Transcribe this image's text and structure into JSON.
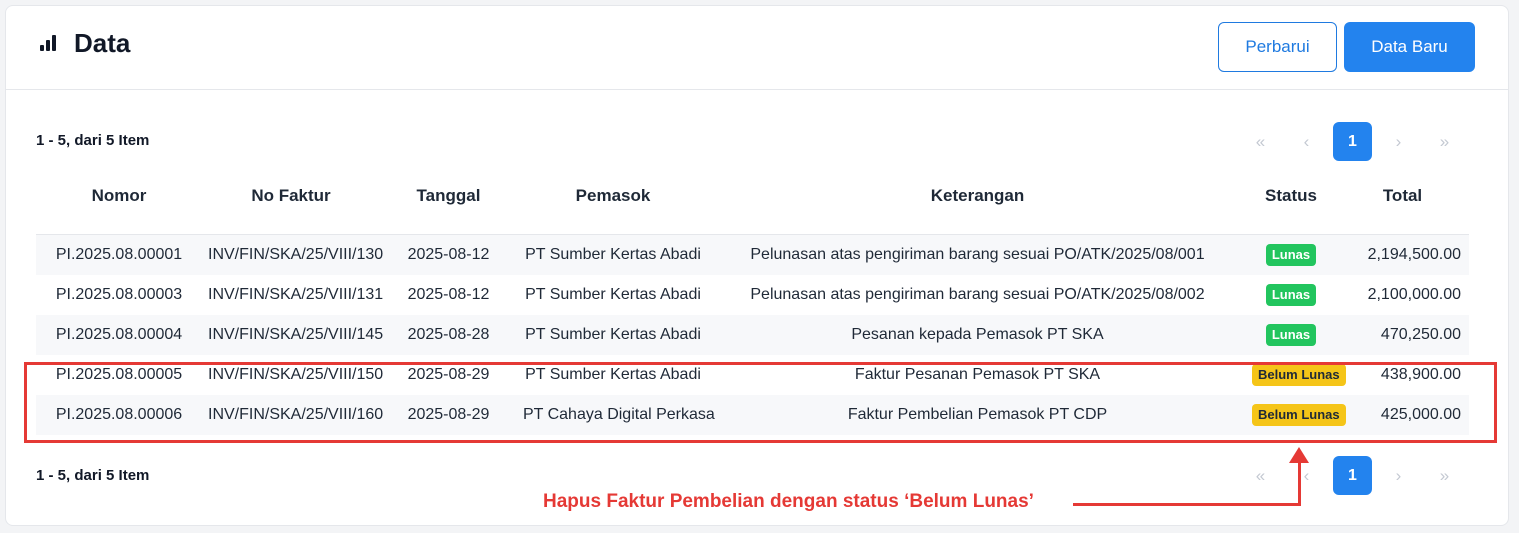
{
  "header": {
    "title": "Data",
    "icon": "bar-chart-icon",
    "refresh_label": "Perbarui",
    "new_label": "Data Baru"
  },
  "summary_top": "1 - 5, dari 5 Item",
  "summary_bottom": "1 - 5, dari 5 Item",
  "pagination": {
    "first": "«",
    "prev": "‹",
    "current": "1",
    "next": "›",
    "last": "»"
  },
  "table": {
    "columns": [
      "Nomor",
      "No Faktur",
      "Tanggal",
      "Pemasok",
      "Keterangan",
      "Status",
      "Total"
    ],
    "rows": [
      {
        "nomor": "PI.2025.08.00001",
        "faktur": "INV/FIN/SKA/25/VIII/130",
        "tanggal": "2025-08-12",
        "pemasok": "PT Sumber Kertas Abadi",
        "keterangan": "Pelunasan atas pengiriman barang sesuai PO/ATK/2025/08/001",
        "status": "Lunas",
        "total": "2,194,500.00"
      },
      {
        "nomor": "PI.2025.08.00003",
        "faktur": "INV/FIN/SKA/25/VIII/131",
        "tanggal": "2025-08-12",
        "pemasok": "PT Sumber Kertas Abadi",
        "keterangan": "Pelunasan atas pengiriman barang sesuai PO/ATK/2025/08/002",
        "status": "Lunas",
        "total": "2,100,000.00"
      },
      {
        "nomor": "PI.2025.08.00004",
        "faktur": "INV/FIN/SKA/25/VIII/145",
        "tanggal": "2025-08-28",
        "pemasok": "PT Sumber Kertas Abadi",
        "keterangan": "Pesanan kepada Pemasok PT SKA",
        "status": "Lunas",
        "total": "470,250.00"
      },
      {
        "nomor": "PI.2025.08.00005",
        "faktur": "INV/FIN/SKA/25/VIII/150",
        "tanggal": "2025-08-29",
        "pemasok": "PT Sumber Kertas Abadi",
        "keterangan": "Faktur Pesanan Pemasok PT SKA",
        "status": "Belum Lunas",
        "total": "438,900.00"
      },
      {
        "nomor": "PI.2025.08.00006",
        "faktur": "INV/FIN/SKA/25/VIII/160",
        "tanggal": "2025-08-29",
        "pemasok": "PT Cahaya Digital Perkasa",
        "keterangan": "Faktur Pembelian Pemasok PT CDP",
        "status": "Belum Lunas",
        "total": "425,000.00"
      }
    ]
  },
  "annotation": {
    "text": "Hapus Faktur Pembelian dengan status ‘Belum Lunas’",
    "color": "#e53935"
  },
  "colors": {
    "primary": "#2383ee",
    "lunas": "#22c55e",
    "belum_lunas": "#f5c518"
  }
}
